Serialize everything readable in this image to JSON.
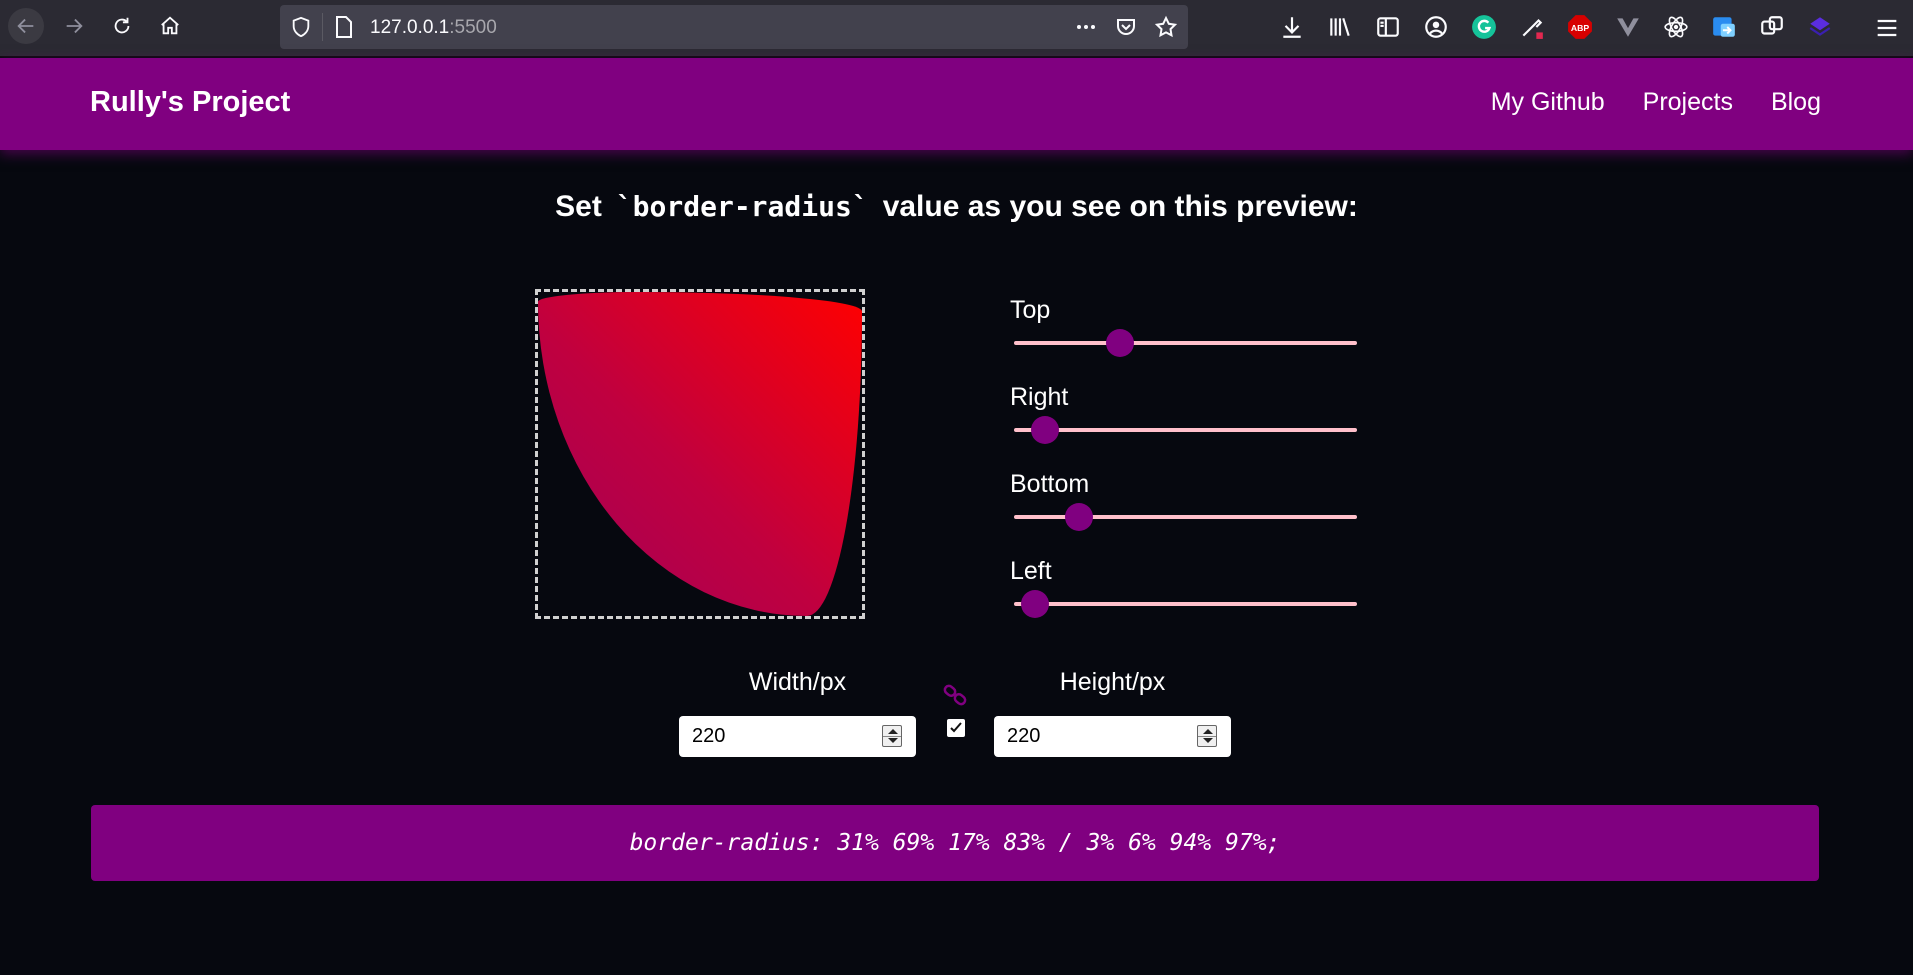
{
  "browser": {
    "url_host": "127.0.0.1",
    "url_port": ":5500"
  },
  "header": {
    "title": "Rully's Project",
    "nav": [
      {
        "label": "My Github"
      },
      {
        "label": "Projects"
      },
      {
        "label": "Blog"
      }
    ]
  },
  "main": {
    "heading_before": "Set",
    "heading_code": "`border-radius`",
    "heading_after": "value as you see on this preview:",
    "sliders": [
      {
        "label": "Top",
        "value_pct": 31
      },
      {
        "label": "Right",
        "value_pct": 9
      },
      {
        "label": "Bottom",
        "value_pct": 19
      },
      {
        "label": "Left",
        "value_pct": 6
      }
    ],
    "width_label": "Width/px",
    "width_value": "220",
    "height_label": "Height/px",
    "height_value": "220",
    "lock_checked": true,
    "css_output": "border-radius: 31% 69% 17% 83% / 3% 6% 94% 97%;"
  },
  "colors": {
    "accent": "#800080",
    "slider_track": "#ffc0cb",
    "background": "#06080f"
  }
}
